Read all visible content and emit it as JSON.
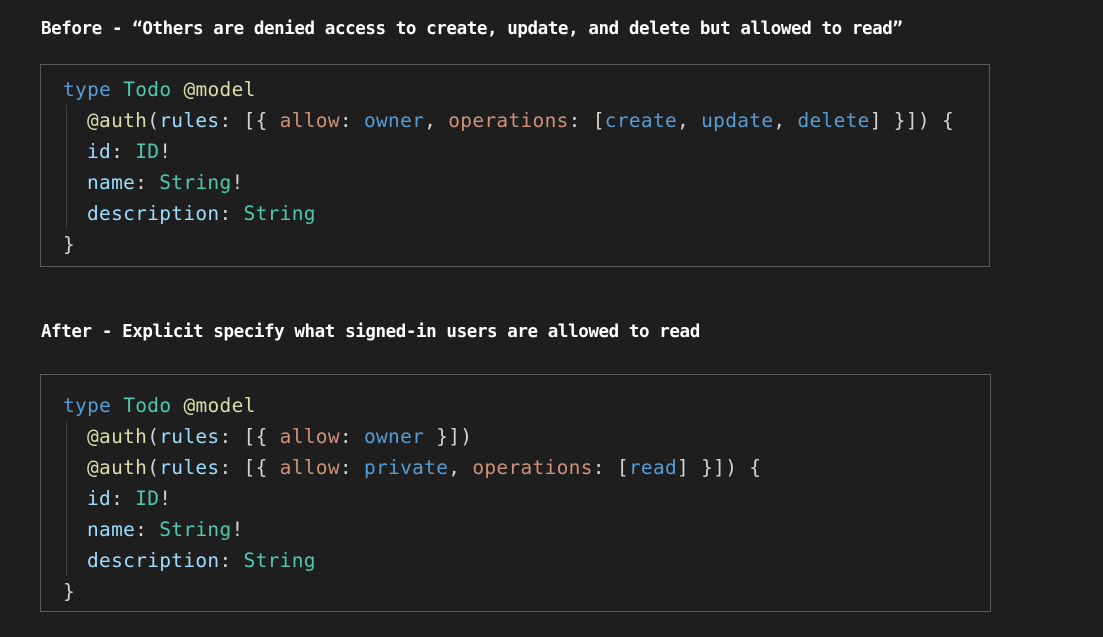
{
  "headings": {
    "before": "Before - “Others are denied access to create, update, and delete but allowed to read”",
    "after": "After - Explicit specify what signed-in users are allowed to read"
  },
  "before_code": {
    "type_kw": "type",
    "type_name": "Todo",
    "model": "@model",
    "auth": "@auth",
    "rules": "rules",
    "allow": "allow",
    "owner": "owner",
    "operations": "operations",
    "create": "create",
    "update": "update",
    "delete": "delete",
    "id": "id",
    "ID": "ID",
    "name": "name",
    "String": "String",
    "description": "description"
  },
  "after_code": {
    "type_kw": "type",
    "type_name": "Todo",
    "model": "@model",
    "auth": "@auth",
    "rules": "rules",
    "allow": "allow",
    "owner": "owner",
    "private": "private",
    "operations": "operations",
    "read": "read",
    "id": "id",
    "ID": "ID",
    "name": "name",
    "String": "String",
    "description": "description"
  },
  "colors": {
    "background": "#1e1e1e",
    "keyword": "#569cd6",
    "type": "#4ec9b0",
    "decorator": "#dcdcaa",
    "property": "#9cdcfe",
    "argument_key": "#ce9178",
    "punctuation": "#d4d4d4"
  }
}
